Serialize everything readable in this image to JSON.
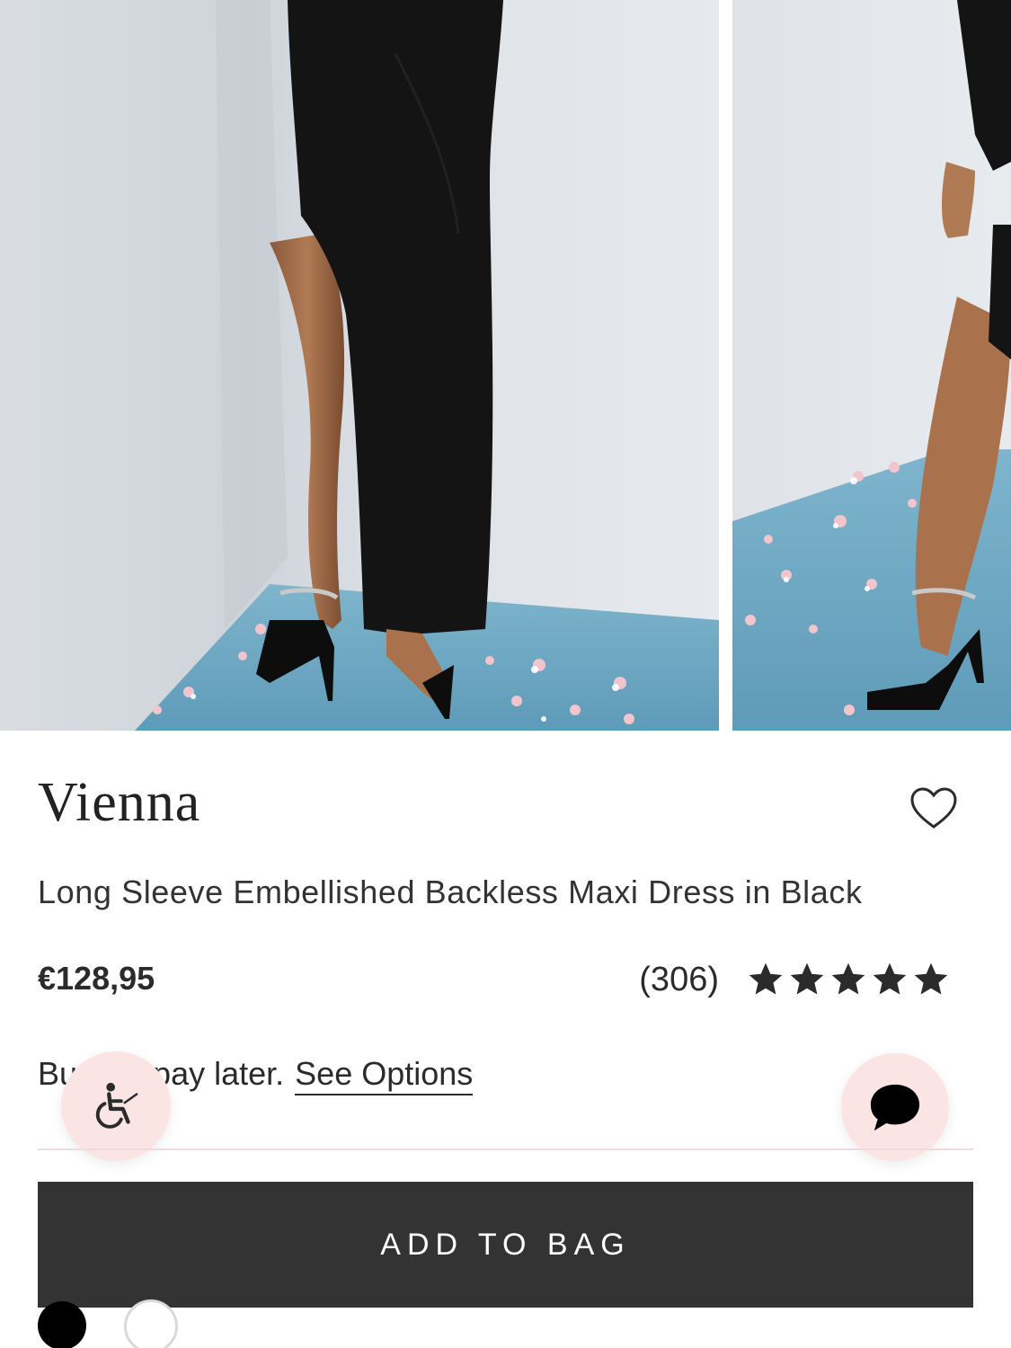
{
  "product": {
    "brand": "Vienna",
    "title": "Long Sleeve Embellished Backless Maxi Dress in Black",
    "price": "€128,95",
    "review_count": "(306)",
    "rating": 5,
    "rating_max": 5
  },
  "payment": {
    "text": "Bu    w, pay later.",
    "link_label": "See Options"
  },
  "cta": {
    "add_to_bag_label": "ADD TO BAG"
  },
  "colors": {
    "accent_bg": "#fbe4e4",
    "button_bg": "#333333",
    "divider": "#f3d9dc",
    "swatches": [
      "#000000",
      "#ffffff"
    ]
  },
  "icons": {
    "wishlist": "heart-outline-icon",
    "accessibility": "wheelchair-icon",
    "chat": "chat-bubble-icon",
    "rating": "star-icon"
  }
}
